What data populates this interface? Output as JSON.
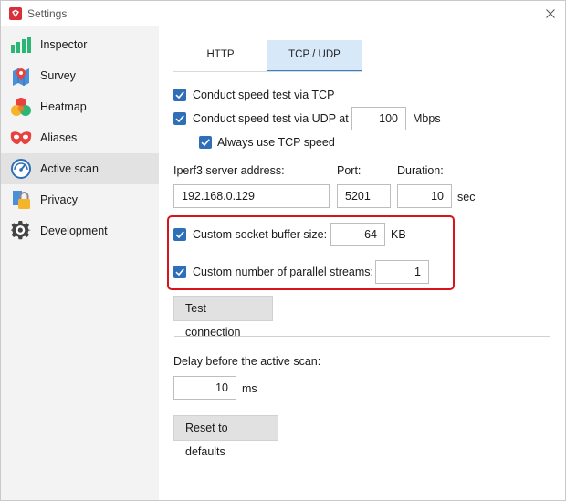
{
  "window": {
    "title": "Settings"
  },
  "sidebar": {
    "items": [
      {
        "label": "Inspector",
        "icon": "bar-chart-icon"
      },
      {
        "label": "Survey",
        "icon": "map-pin-icon"
      },
      {
        "label": "Heatmap",
        "icon": "heatmap-icon"
      },
      {
        "label": "Aliases",
        "icon": "mask-icon"
      },
      {
        "label": "Active scan",
        "icon": "speedometer-icon",
        "active": true
      },
      {
        "label": "Privacy",
        "icon": "lock-icon"
      },
      {
        "label": "Development",
        "icon": "gear-icon"
      }
    ]
  },
  "tabs": [
    {
      "label": "HTTP",
      "selected": false
    },
    {
      "label": "TCP / UDP",
      "selected": true
    }
  ],
  "speed_test": {
    "tcp_label": "Conduct speed test via TCP",
    "tcp_checked": true,
    "udp_label": "Conduct speed test via UDP at",
    "udp_checked": true,
    "udp_rate": "100",
    "udp_unit": "Mbps",
    "always_tcp_label": "Always use TCP speed",
    "always_tcp_checked": true
  },
  "server": {
    "address_label": "Iperf3 server address:",
    "address_value": "192.168.0.129",
    "port_label": "Port:",
    "port_value": "5201",
    "duration_label": "Duration:",
    "duration_value": "10",
    "duration_unit": "sec"
  },
  "buffer": {
    "label": "Custom socket buffer size:",
    "checked": true,
    "value": "64",
    "unit": "KB"
  },
  "streams": {
    "label": "Custom number of parallel streams:",
    "checked": true,
    "value": "1"
  },
  "buttons": {
    "test_connection": "Test connection",
    "reset_defaults": "Reset to defaults"
  },
  "delay": {
    "label": "Delay before the active scan:",
    "value": "10",
    "unit": "ms"
  },
  "colors": {
    "accent": "#2f6fb7",
    "tab_selected_bg": "#d7e9f9",
    "highlight_border": "#d8131c",
    "sidebar_bg": "#f3f3f3"
  }
}
